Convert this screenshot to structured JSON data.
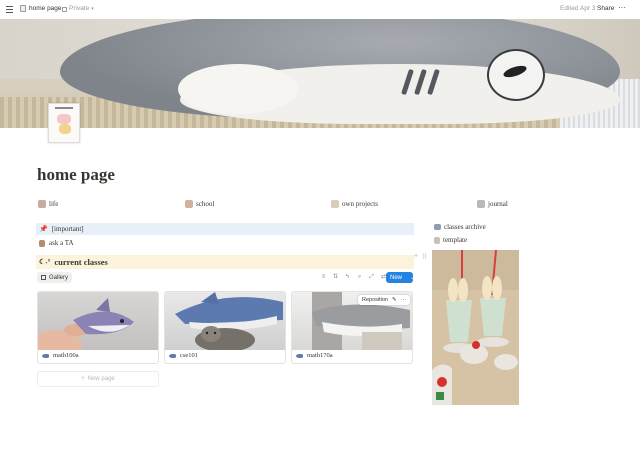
{
  "topbar": {
    "breadcrumb": "home page",
    "privacy": "Private",
    "edited": "Edited Apr 3",
    "share": "Share",
    "more": "···"
  },
  "page": {
    "title": "home page"
  },
  "links": [
    {
      "label": "life",
      "icon": "doll-icon"
    },
    {
      "label": "school",
      "icon": "doll-icon"
    },
    {
      "label": "own projects",
      "icon": "doll-icon"
    },
    {
      "label": "journal",
      "icon": "doll-icon"
    }
  ],
  "important": {
    "label": "[important]",
    "icon": "pin-icon"
  },
  "todo": {
    "label": "ask a TA",
    "icon": "clipboard-icon"
  },
  "current_classes": {
    "label": "current classes",
    "icon": "moon-icon"
  },
  "gallery": {
    "view_label": "Gallery",
    "new_label": "New",
    "reposition_label": "Reposition",
    "new_page_label": "New page",
    "cards": [
      {
        "label": "math100a"
      },
      {
        "label": "cse101"
      },
      {
        "label": "math170a"
      }
    ]
  },
  "sidebar": {
    "classes_archive": "classes archive",
    "template": "template"
  },
  "colors": {
    "accent": "#2383e2",
    "callout_blue": "#e7f0f8",
    "callout_yellow": "#fbf3db"
  }
}
